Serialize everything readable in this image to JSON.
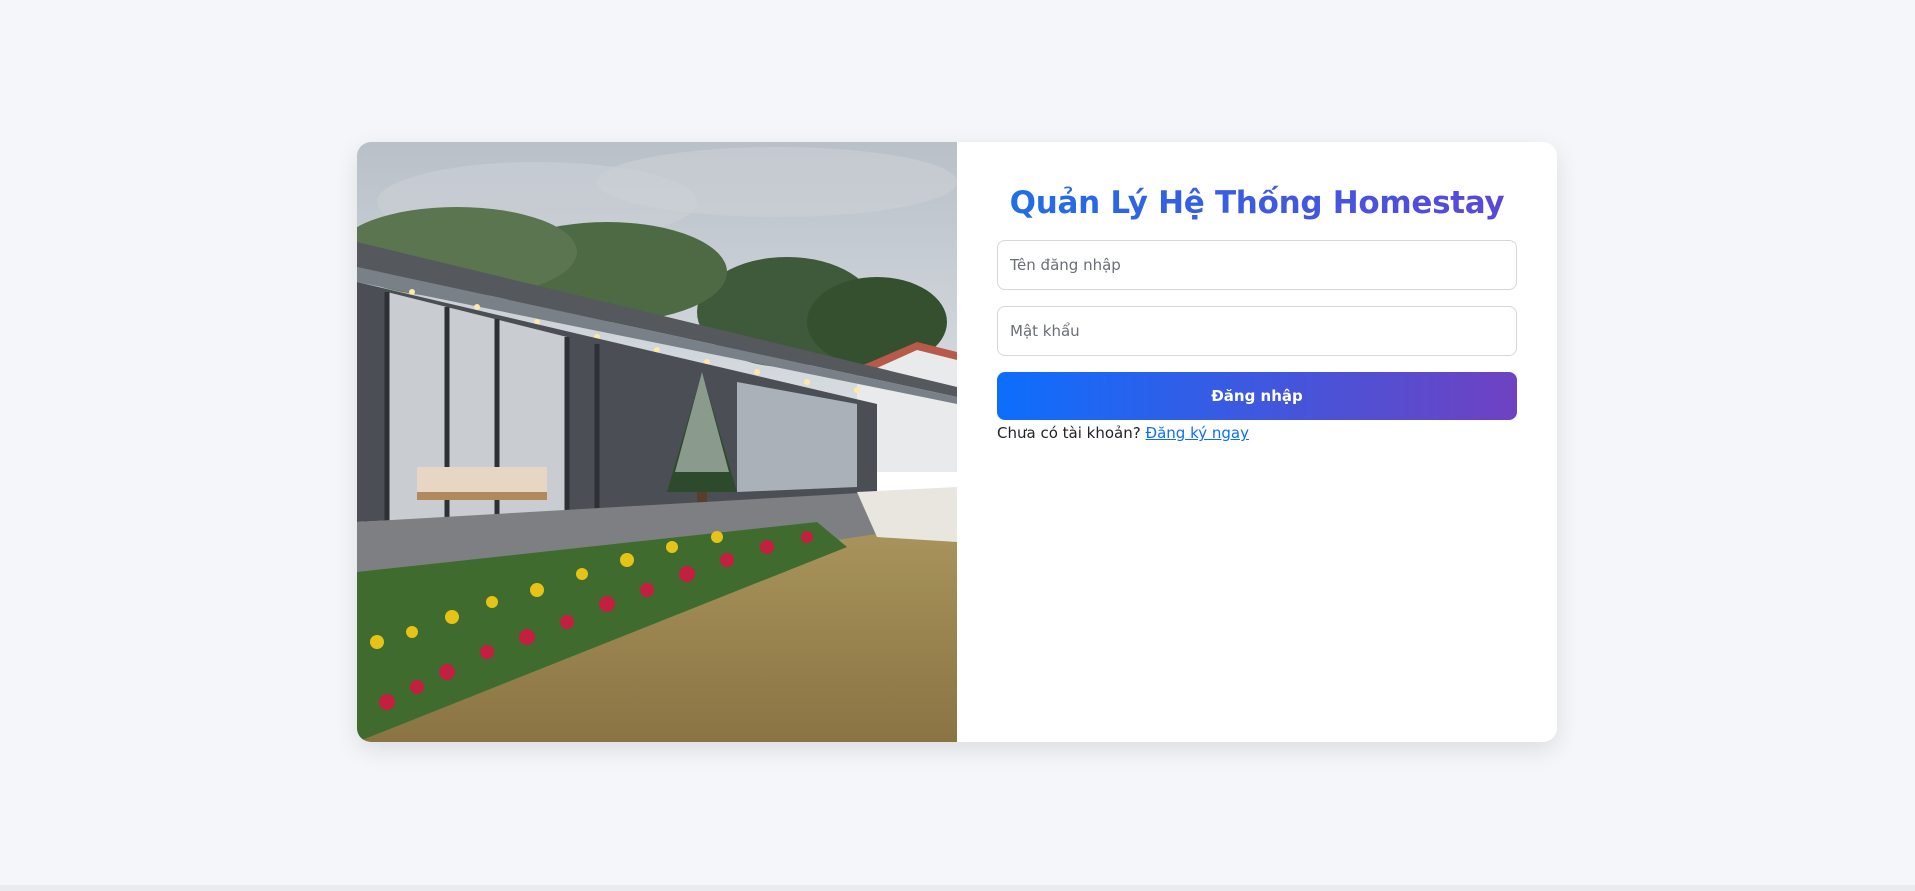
{
  "login": {
    "title": "Quản Lý Hệ Thống Homestay",
    "username_placeholder": "Tên đăng nhập",
    "password_placeholder": "Mật khẩu",
    "submit_label": "Đăng nhập",
    "no_account_text": "Chưa có tài khoản?",
    "register_link": "Đăng ký ngay"
  },
  "colors": {
    "page_bg": "#f4f6fa",
    "gradient_start": "#0d6efd",
    "gradient_end": "#6f42c1",
    "link": "#0d6efd"
  },
  "image": {
    "icon": "homestay-photo"
  }
}
